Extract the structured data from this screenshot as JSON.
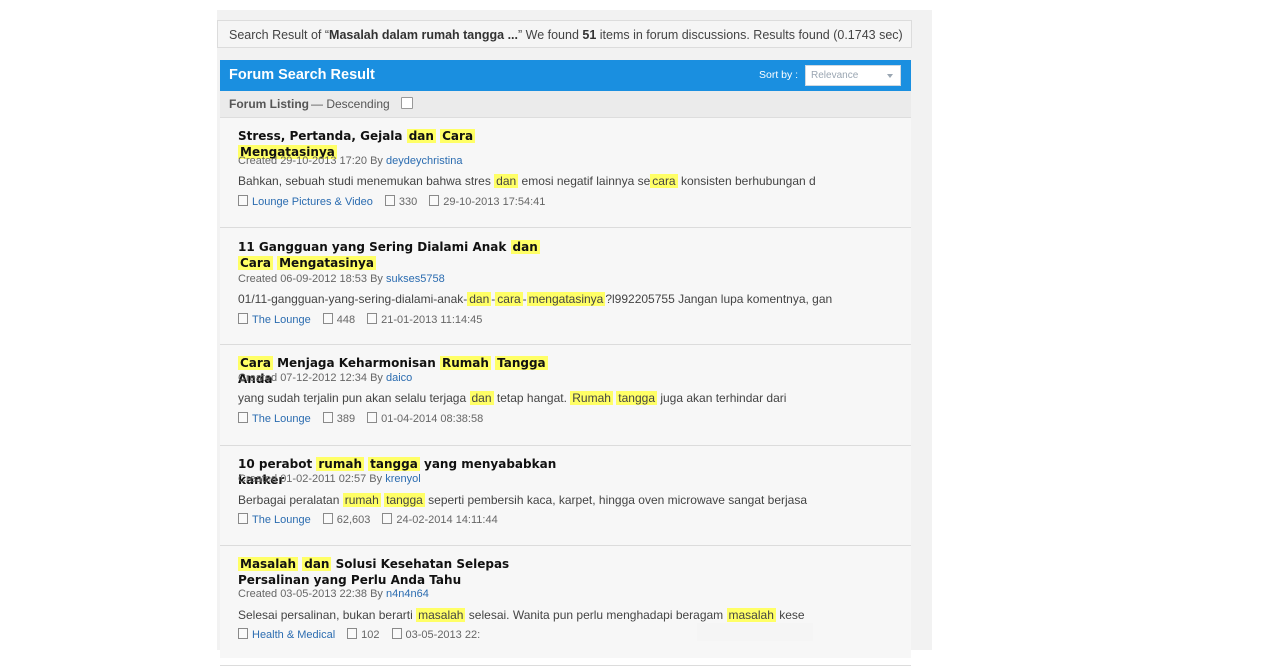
{
  "summary": {
    "prefix": "Search Result of “",
    "query": "Masalah dalam rumah tangga ...",
    "middle": "” We found ",
    "count": "51",
    "suffix": " items in forum discussions. Results found (0.1743 sec)"
  },
  "header": {
    "title": "Forum Search Result",
    "sort_label": "Sort by :",
    "sort_value": "Relevance"
  },
  "listing": {
    "title": "Forum Listing",
    "order": "— Descending"
  },
  "results": [
    {
      "title": [
        [
          "Stress, Pertanda, Gejala ",
          false
        ],
        [
          "dan",
          true
        ],
        [
          " ",
          false
        ],
        [
          "Cara",
          true
        ],
        [
          " ",
          false
        ],
        [
          "Mengatasinya",
          true
        ]
      ],
      "created": "Created 29-10-2013 17:20 By ",
      "author": "deydeychristina",
      "snippet": [
        [
          "Bahkan, sebuah studi menemukan bahwa stres ",
          false
        ],
        [
          "dan",
          true
        ],
        [
          " emosi negatif lainnya se",
          false
        ],
        [
          "cara",
          true
        ],
        [
          " konsisten berhubungan d",
          false
        ]
      ],
      "forum": "Lounge Pictures & Video",
      "views": "330",
      "last": "29-10-2013 17:54:41"
    },
    {
      "title": [
        [
          "11 Gangguan yang Sering Dialami Anak ",
          false
        ],
        [
          "dan",
          true
        ],
        [
          " ",
          false
        ],
        [
          "Cara",
          true
        ],
        [
          " ",
          false
        ],
        [
          "Mengatasinya",
          true
        ]
      ],
      "created": "Created 06-09-2012 18:53 By ",
      "author": "sukses5758",
      "snippet": [
        [
          "01/11-gangguan-yang-sering-dialami-anak-",
          false
        ],
        [
          "dan",
          true
        ],
        [
          "-",
          false
        ],
        [
          "cara",
          true
        ],
        [
          "-",
          false
        ],
        [
          "mengatasinya",
          true
        ],
        [
          "?l992205755 Jangan lupa komentnya, gan",
          false
        ]
      ],
      "forum": "The Lounge",
      "views": "448",
      "last": "21-01-2013 11:14:45"
    },
    {
      "title": [
        [
          "Cara",
          true
        ],
        [
          " Menjaga Keharmonisan ",
          false
        ],
        [
          "Rumah",
          true
        ],
        [
          " ",
          false
        ],
        [
          "Tangga",
          true
        ],
        [
          " Anda",
          false
        ]
      ],
      "created": "Created 07-12-2012 12:34 By ",
      "author": "daico",
      "snippet": [
        [
          "yang sudah terjalin pun akan selalu terjaga ",
          false
        ],
        [
          "dan",
          true
        ],
        [
          " tetap hangat. ",
          false
        ],
        [
          "Rumah",
          true
        ],
        [
          " ",
          false
        ],
        [
          "tangga",
          true
        ],
        [
          " juga akan terhindar dari",
          false
        ]
      ],
      "forum": "The Lounge",
      "views": "389",
      "last": "01-04-2014 08:38:58"
    },
    {
      "title": [
        [
          "10 perabot ",
          false
        ],
        [
          "rumah",
          true
        ],
        [
          " ",
          false
        ],
        [
          "tangga",
          true
        ],
        [
          " yang menyababkan kanker",
          false
        ]
      ],
      "created": "Created 01-02-2011 02:57 By ",
      "author": "krenyol",
      "snippet": [
        [
          "Berbagai peralatan ",
          false
        ],
        [
          "rumah",
          true
        ],
        [
          " ",
          false
        ],
        [
          "tangga",
          true
        ],
        [
          " seperti pembersih kaca, karpet, hingga oven microwave sangat berjasa",
          false
        ]
      ],
      "forum": "The Lounge",
      "views": "62,603",
      "last": "24-02-2014 14:11:44"
    },
    {
      "title": [
        [
          "Masalah",
          true
        ],
        [
          " ",
          false
        ],
        [
          "dan",
          true
        ],
        [
          " Solusi Kesehatan Selepas Persalinan yang Perlu Anda Tahu",
          false
        ]
      ],
      "created": "Created 03-05-2013 22:38 By ",
      "author": "n4n4n64",
      "snippet": [
        [
          "Selesai persalinan, bukan berarti ",
          false
        ],
        [
          "masalah",
          true
        ],
        [
          " selesai. Wanita pun perlu menghadapi beragam ",
          false
        ],
        [
          "masalah",
          true
        ],
        [
          " kese",
          false
        ]
      ],
      "forum": "Health & Medical",
      "views": "102",
      "last": "03-05-2013 22:"
    }
  ]
}
